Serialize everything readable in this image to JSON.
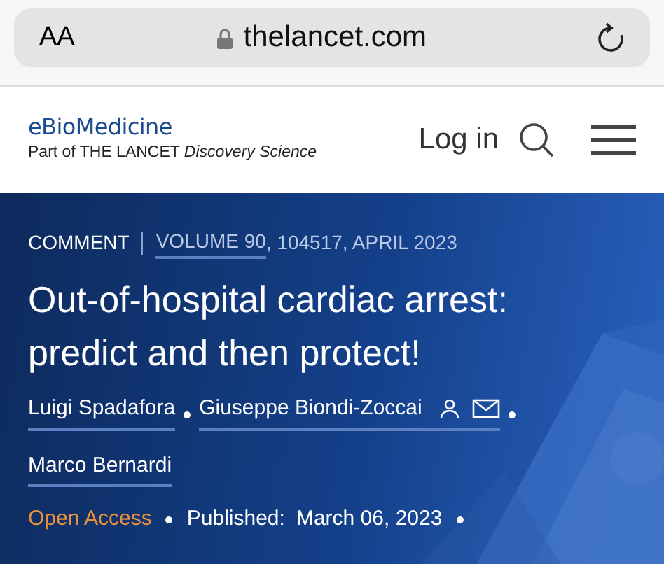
{
  "browser": {
    "text_size_button": "AA",
    "address": "thelancet.com"
  },
  "header": {
    "journal": "eBioMedicine",
    "tagline_prefix": "Part of THE LANCET",
    "tagline_suffix": "Discovery Science",
    "login": "Log in"
  },
  "article": {
    "type": "COMMENT",
    "volume": "VOLUME 90",
    "issue_info": ", 104517, APRIL 2023",
    "title": "Out-of-hospital cardiac arrest: predict and then protect!",
    "authors": [
      {
        "name": "Luigi Spadafora",
        "corresponding": false
      },
      {
        "name": "Giuseppe Biondi-Zoccai",
        "corresponding": true
      },
      {
        "name": "Marco Bernardi",
        "corresponding": false
      }
    ],
    "access": "Open Access",
    "published_label": "Published:",
    "published_date": "March 06, 2023"
  }
}
